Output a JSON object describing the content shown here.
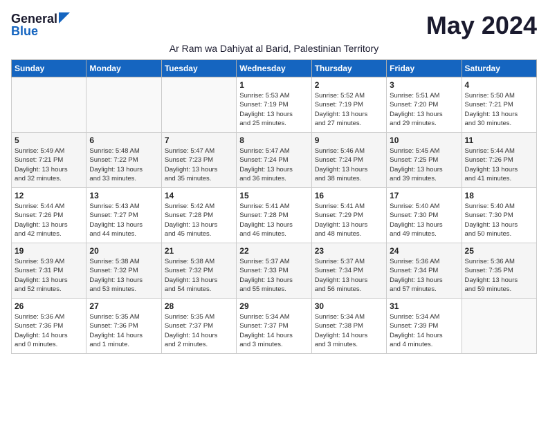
{
  "logo": {
    "general": "General",
    "blue": "Blue"
  },
  "title": "May 2024",
  "subtitle": "Ar Ram wa Dahiyat al Barid, Palestinian Territory",
  "headers": [
    "Sunday",
    "Monday",
    "Tuesday",
    "Wednesday",
    "Thursday",
    "Friday",
    "Saturday"
  ],
  "weeks": [
    [
      {
        "day": "",
        "info": ""
      },
      {
        "day": "",
        "info": ""
      },
      {
        "day": "",
        "info": ""
      },
      {
        "day": "1",
        "info": "Sunrise: 5:53 AM\nSunset: 7:19 PM\nDaylight: 13 hours\nand 25 minutes."
      },
      {
        "day": "2",
        "info": "Sunrise: 5:52 AM\nSunset: 7:19 PM\nDaylight: 13 hours\nand 27 minutes."
      },
      {
        "day": "3",
        "info": "Sunrise: 5:51 AM\nSunset: 7:20 PM\nDaylight: 13 hours\nand 29 minutes."
      },
      {
        "day": "4",
        "info": "Sunrise: 5:50 AM\nSunset: 7:21 PM\nDaylight: 13 hours\nand 30 minutes."
      }
    ],
    [
      {
        "day": "5",
        "info": "Sunrise: 5:49 AM\nSunset: 7:21 PM\nDaylight: 13 hours\nand 32 minutes."
      },
      {
        "day": "6",
        "info": "Sunrise: 5:48 AM\nSunset: 7:22 PM\nDaylight: 13 hours\nand 33 minutes."
      },
      {
        "day": "7",
        "info": "Sunrise: 5:47 AM\nSunset: 7:23 PM\nDaylight: 13 hours\nand 35 minutes."
      },
      {
        "day": "8",
        "info": "Sunrise: 5:47 AM\nSunset: 7:24 PM\nDaylight: 13 hours\nand 36 minutes."
      },
      {
        "day": "9",
        "info": "Sunrise: 5:46 AM\nSunset: 7:24 PM\nDaylight: 13 hours\nand 38 minutes."
      },
      {
        "day": "10",
        "info": "Sunrise: 5:45 AM\nSunset: 7:25 PM\nDaylight: 13 hours\nand 39 minutes."
      },
      {
        "day": "11",
        "info": "Sunrise: 5:44 AM\nSunset: 7:26 PM\nDaylight: 13 hours\nand 41 minutes."
      }
    ],
    [
      {
        "day": "12",
        "info": "Sunrise: 5:44 AM\nSunset: 7:26 PM\nDaylight: 13 hours\nand 42 minutes."
      },
      {
        "day": "13",
        "info": "Sunrise: 5:43 AM\nSunset: 7:27 PM\nDaylight: 13 hours\nand 44 minutes."
      },
      {
        "day": "14",
        "info": "Sunrise: 5:42 AM\nSunset: 7:28 PM\nDaylight: 13 hours\nand 45 minutes."
      },
      {
        "day": "15",
        "info": "Sunrise: 5:41 AM\nSunset: 7:28 PM\nDaylight: 13 hours\nand 46 minutes."
      },
      {
        "day": "16",
        "info": "Sunrise: 5:41 AM\nSunset: 7:29 PM\nDaylight: 13 hours\nand 48 minutes."
      },
      {
        "day": "17",
        "info": "Sunrise: 5:40 AM\nSunset: 7:30 PM\nDaylight: 13 hours\nand 49 minutes."
      },
      {
        "day": "18",
        "info": "Sunrise: 5:40 AM\nSunset: 7:30 PM\nDaylight: 13 hours\nand 50 minutes."
      }
    ],
    [
      {
        "day": "19",
        "info": "Sunrise: 5:39 AM\nSunset: 7:31 PM\nDaylight: 13 hours\nand 52 minutes."
      },
      {
        "day": "20",
        "info": "Sunrise: 5:38 AM\nSunset: 7:32 PM\nDaylight: 13 hours\nand 53 minutes."
      },
      {
        "day": "21",
        "info": "Sunrise: 5:38 AM\nSunset: 7:32 PM\nDaylight: 13 hours\nand 54 minutes."
      },
      {
        "day": "22",
        "info": "Sunrise: 5:37 AM\nSunset: 7:33 PM\nDaylight: 13 hours\nand 55 minutes."
      },
      {
        "day": "23",
        "info": "Sunrise: 5:37 AM\nSunset: 7:34 PM\nDaylight: 13 hours\nand 56 minutes."
      },
      {
        "day": "24",
        "info": "Sunrise: 5:36 AM\nSunset: 7:34 PM\nDaylight: 13 hours\nand 57 minutes."
      },
      {
        "day": "25",
        "info": "Sunrise: 5:36 AM\nSunset: 7:35 PM\nDaylight: 13 hours\nand 59 minutes."
      }
    ],
    [
      {
        "day": "26",
        "info": "Sunrise: 5:36 AM\nSunset: 7:36 PM\nDaylight: 14 hours\nand 0 minutes."
      },
      {
        "day": "27",
        "info": "Sunrise: 5:35 AM\nSunset: 7:36 PM\nDaylight: 14 hours\nand 1 minute."
      },
      {
        "day": "28",
        "info": "Sunrise: 5:35 AM\nSunset: 7:37 PM\nDaylight: 14 hours\nand 2 minutes."
      },
      {
        "day": "29",
        "info": "Sunrise: 5:34 AM\nSunset: 7:37 PM\nDaylight: 14 hours\nand 3 minutes."
      },
      {
        "day": "30",
        "info": "Sunrise: 5:34 AM\nSunset: 7:38 PM\nDaylight: 14 hours\nand 3 minutes."
      },
      {
        "day": "31",
        "info": "Sunrise: 5:34 AM\nSunset: 7:39 PM\nDaylight: 14 hours\nand 4 minutes."
      },
      {
        "day": "",
        "info": ""
      }
    ]
  ]
}
